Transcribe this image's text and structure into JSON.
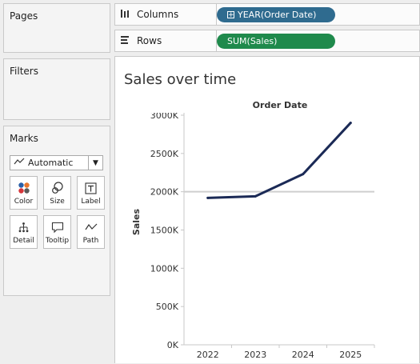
{
  "panels": {
    "pages_title": "Pages",
    "filters_title": "Filters",
    "marks_title": "Marks"
  },
  "marks": {
    "mark_type": "Automatic",
    "buttons": [
      "Color",
      "Size",
      "Label",
      "Detail",
      "Tooltip",
      "Path"
    ]
  },
  "shelves": {
    "columns_label": "Columns",
    "columns_pill": "YEAR(Order Date)",
    "rows_label": "Rows",
    "rows_pill": "SUM(Sales)"
  },
  "colors": {
    "columns_pill": "#2f6b8f",
    "rows_pill": "#1f8a4c",
    "line": "#1b2a56"
  },
  "view": {
    "sheet_title": "Sales over time"
  },
  "chart_data": {
    "type": "line",
    "title": "",
    "column_header": "Order Date",
    "xlabel": "",
    "ylabel": "Sales",
    "categories": [
      "2022",
      "2023",
      "2024",
      "2025"
    ],
    "values": [
      1920000,
      1940000,
      2230000,
      2900000
    ],
    "yticks": [
      "0K",
      "500K",
      "1000K",
      "1500K",
      "2000K",
      "2500K",
      "3000K"
    ],
    "ylim": [
      0,
      3000000
    ],
    "grid": "reference line at 2000K"
  }
}
